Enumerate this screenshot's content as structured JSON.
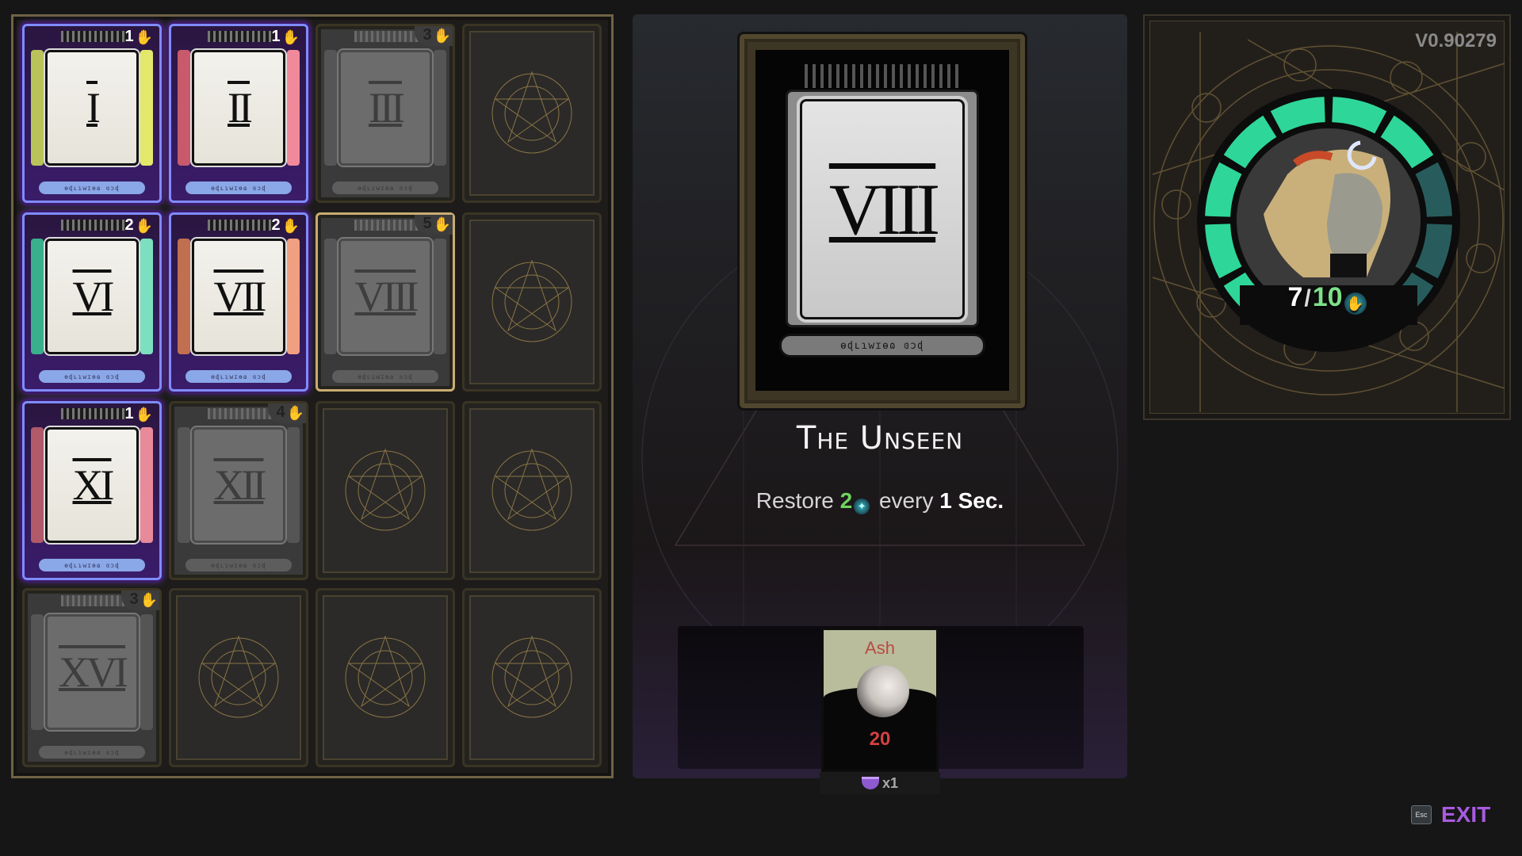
{
  "version": "V0.90279",
  "arcana_grid": {
    "cards": [
      {
        "numeral": "I",
        "state": "equipped",
        "cost": "1",
        "colors": [
          "#b9c35a",
          "#e3e86b"
        ]
      },
      {
        "numeral": "II",
        "state": "equipped",
        "cost": "1",
        "colors": [
          "#c85a6b",
          "#f08a9a"
        ]
      },
      {
        "numeral": "III",
        "state": "inactive",
        "cost": "3"
      },
      {
        "numeral": "",
        "state": "locked"
      },
      {
        "numeral": "VI",
        "state": "equipped",
        "cost": "2",
        "colors": [
          "#3aaf8c",
          "#7ce0c0"
        ]
      },
      {
        "numeral": "VII",
        "state": "equipped",
        "cost": "2",
        "colors": [
          "#c07050",
          "#f0a080"
        ]
      },
      {
        "numeral": "VIII",
        "state": "inactive",
        "cost": "5",
        "selected": true
      },
      {
        "numeral": "",
        "state": "locked"
      },
      {
        "numeral": "XI",
        "state": "equipped",
        "cost": "1",
        "colors": [
          "#b05a6a",
          "#e88a9a"
        ]
      },
      {
        "numeral": "XII",
        "state": "inactive",
        "cost": "4"
      },
      {
        "numeral": "",
        "state": "locked"
      },
      {
        "numeral": "",
        "state": "locked"
      },
      {
        "numeral": "XVI",
        "state": "inactive",
        "cost": "3"
      },
      {
        "numeral": "",
        "state": "locked"
      },
      {
        "numeral": "",
        "state": "locked"
      },
      {
        "numeral": "",
        "state": "locked"
      }
    ],
    "banner_script": "ɵɖʟɿwɪɵɷ ɞɔɖ",
    "cost_icon": "hand-icon"
  },
  "detail": {
    "numeral": "VIII",
    "banner_script": "ɵɖʟɿwɪɵɷ ɞɔɖ",
    "title": "The Unseen",
    "desc": {
      "prefix": "Restore ",
      "amount": "2",
      "icon": "grasp-icon",
      "middle": " every ",
      "interval": "1 Sec."
    },
    "reward": {
      "name": "Ash",
      "count": "20",
      "quantity_label": "x1",
      "icon": "ash-icon",
      "qty_icon": "ingredient-icon"
    }
  },
  "grasp": {
    "current": "7",
    "separator": "/",
    "max": "10",
    "segments_total": 10,
    "segments_filled": 7,
    "filled_color": "#2fd69a",
    "empty_color": "#285c5c",
    "icon": "grasp-icon"
  },
  "exit": {
    "key": "Esc",
    "label": "EXIT",
    "color": "#a85be0"
  }
}
